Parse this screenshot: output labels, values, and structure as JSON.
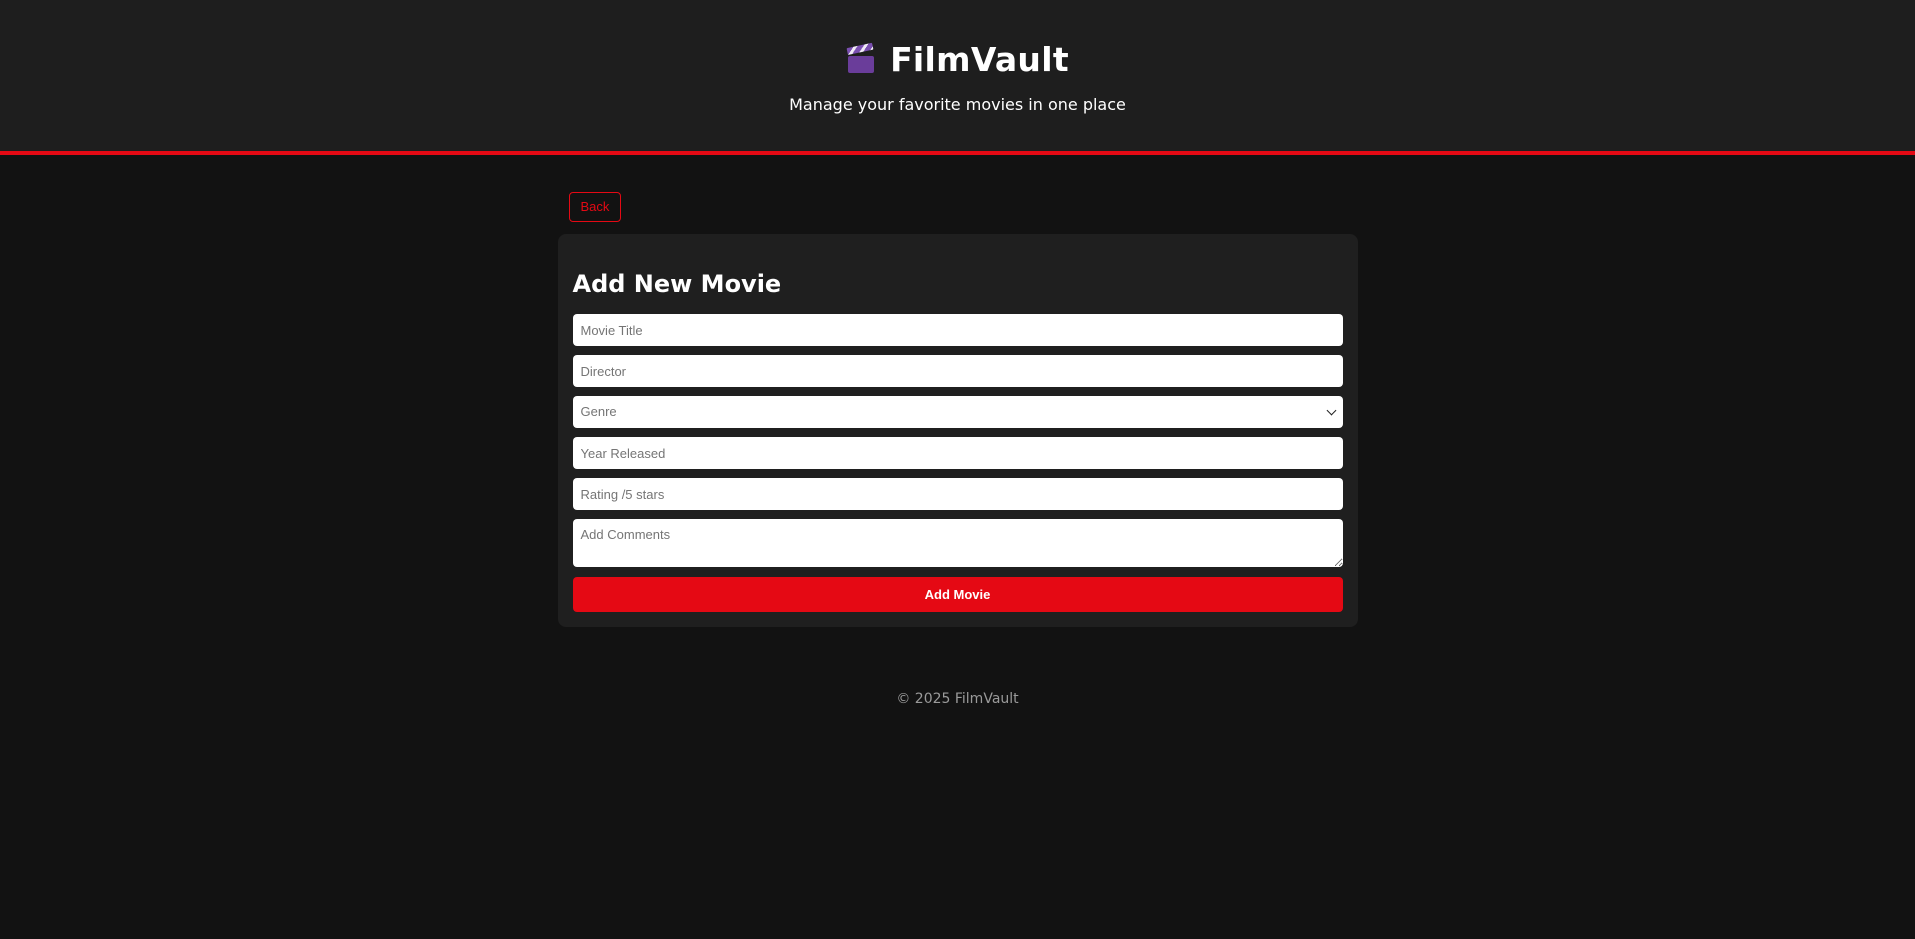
{
  "header": {
    "title": "FilmVault",
    "icon": "clapperboard-icon",
    "tagline": "Manage your favorite movies in one place"
  },
  "nav": {
    "back_label": "Back"
  },
  "form": {
    "heading": "Add New Movie",
    "title_placeholder": "Movie Title",
    "director_placeholder": "Director",
    "genre_selected": "Genre",
    "year_placeholder": "Year Released",
    "rating_placeholder": "Rating /5 stars",
    "comments_placeholder": "Add Comments",
    "submit_label": "Add Movie"
  },
  "footer": {
    "text": "© 2025 FilmVault"
  },
  "colors": {
    "accent": "#e50914",
    "background": "#121212",
    "header_bg": "#1e1e1e",
    "card_bg": "#1f1f1f"
  }
}
